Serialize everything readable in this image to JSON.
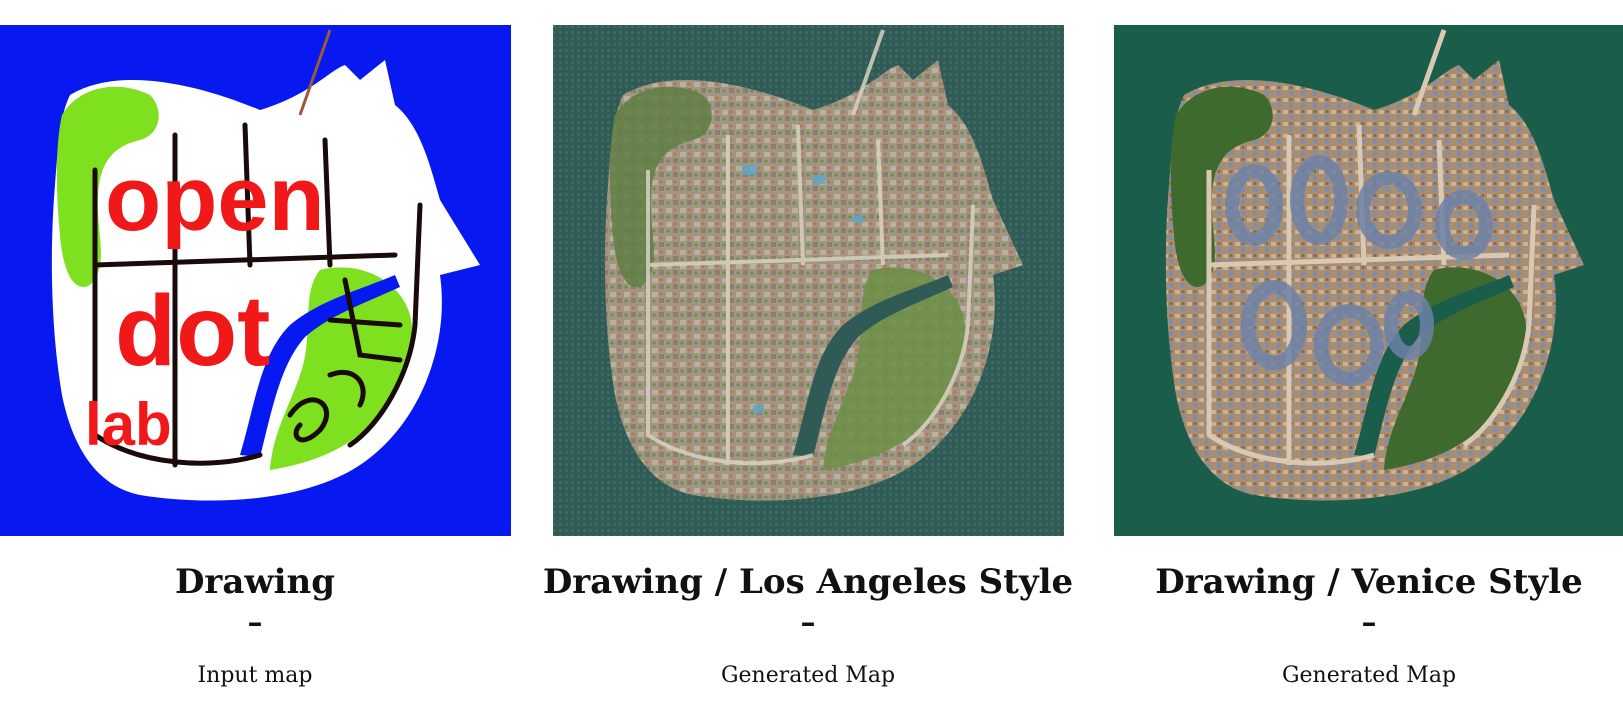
{
  "panels": [
    {
      "title": "Drawing",
      "dash": "–",
      "subtitle": "Input map",
      "map_lettering": [
        "open",
        "dot",
        "lab"
      ],
      "colors": {
        "water": "#0718f0",
        "land": "#ffffff",
        "park": "#7ee01e",
        "letters": "#f01818",
        "roads": "#1a0a0a"
      }
    },
    {
      "title": "Drawing / Los Angeles Style",
      "dash": "–",
      "subtitle": "Generated Map",
      "colors": {
        "water": "#2f5a55",
        "land": "#9c9585",
        "trees": "#6b8f47",
        "roofs": "#c4714a"
      }
    },
    {
      "title": "Drawing / Venice Style",
      "dash": "–",
      "subtitle": "Generated Map",
      "colors": {
        "water": "#1b5d4b",
        "land": "#a98d70",
        "trees": "#3e6a2e",
        "roofs": "#7d8fb0"
      }
    }
  ]
}
